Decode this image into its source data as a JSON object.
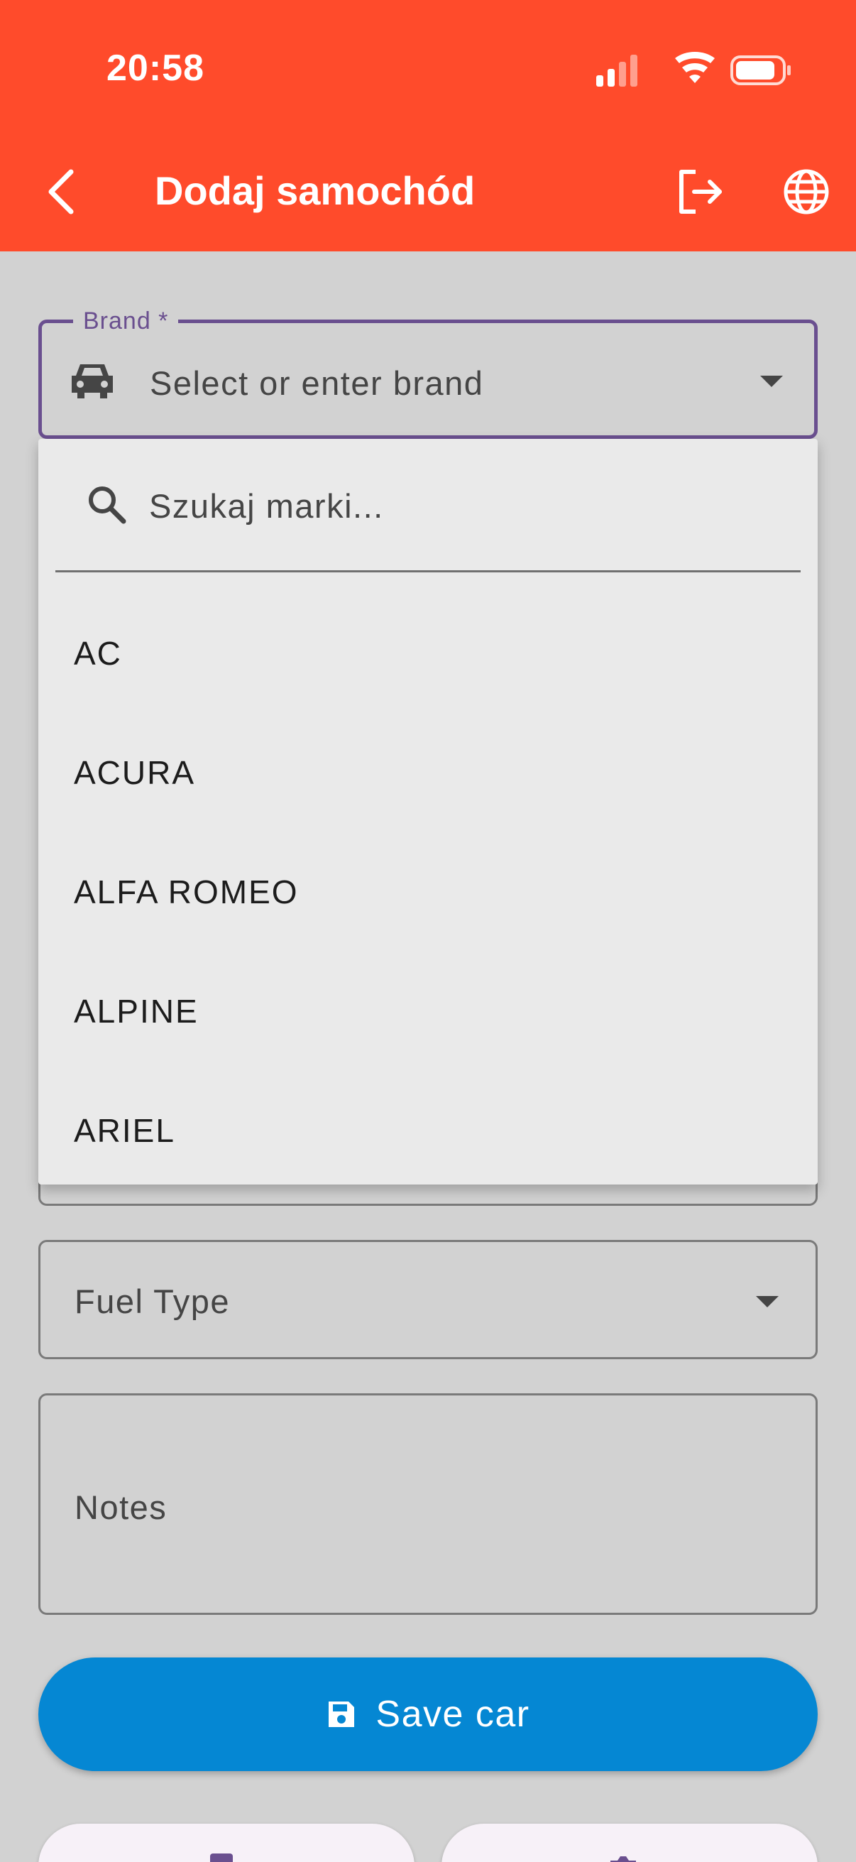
{
  "status_bar": {
    "time": "20:58"
  },
  "app_bar": {
    "title": "Dodaj samochód",
    "back_icon": "chevron-left-icon",
    "logout_icon": "logout-icon",
    "language_icon": "globe-icon"
  },
  "form": {
    "brand": {
      "label": "Brand *",
      "placeholder": "Select or enter brand",
      "icon": "car-icon"
    },
    "brand_dropdown": {
      "search_placeholder": "Szukaj marki...",
      "options": [
        "AC",
        "ACURA",
        "ALFA ROMEO",
        "ALPINE",
        "ARIEL"
      ]
    },
    "fuel_type": {
      "label": "Fuel Type"
    },
    "notes": {
      "label": "Notes"
    },
    "save_button": {
      "label": "Save car",
      "icon": "save-icon"
    }
  },
  "colors": {
    "header": "#ff4b2b",
    "primary_button": "#0587d3",
    "focus_border": "#6a4f8f"
  }
}
